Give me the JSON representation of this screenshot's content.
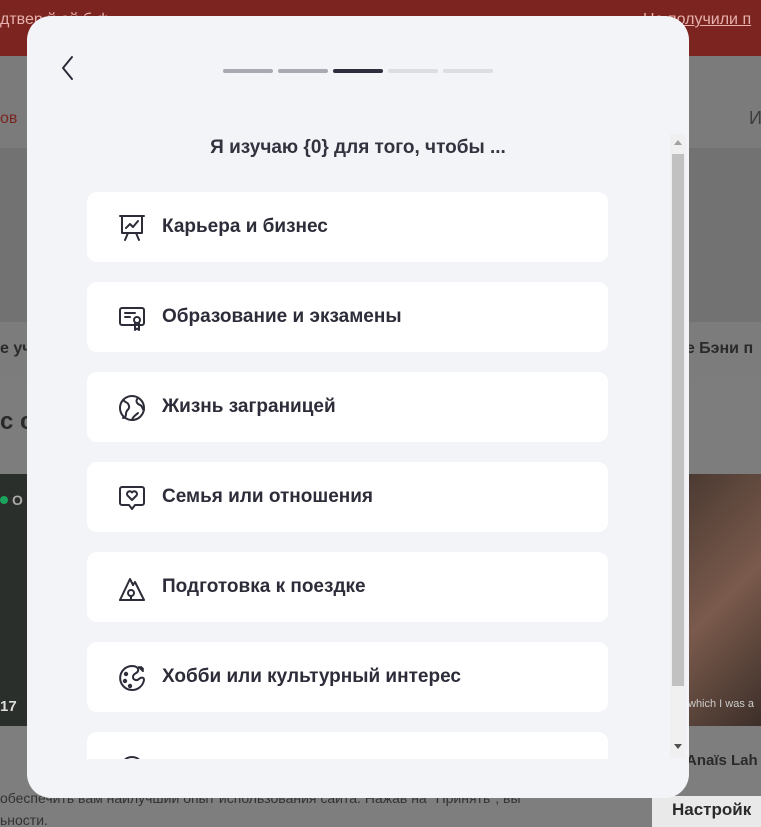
{
  "background": {
    "banner_left": "дтвер    й           ой           б              ф",
    "banner_link": "Не получили п",
    "nav_left": "ов",
    "nav_right": "И",
    "row_left": "е уч",
    "row_right": "те Бэни п",
    "section_left": "с с",
    "online_label": "О",
    "left_card_number": "17",
    "right_card_caption": "which I was a",
    "tutor_name": "Anaïs Lah",
    "cookie_text_1": "обеспечить вам наилучший опыт использования сайта. Нажав на \"Принять\", вы",
    "cookie_text_2": "ьности.",
    "cookie_settings": "Настройк"
  },
  "modal": {
    "back_icon": "chevron-left-icon",
    "progress": {
      "total_steps": 5,
      "current_step": 3
    },
    "title": "Я изучаю {0} для того, чтобы ...",
    "options": [
      {
        "label": "Карьера и бизнес",
        "icon": "presentation-chart-icon"
      },
      {
        "label": "Образование и экзамены",
        "icon": "certificate-icon"
      },
      {
        "label": "Жизнь заграницей",
        "icon": "globe-icon"
      },
      {
        "label": "Семья или отношения",
        "icon": "heart-chat-icon"
      },
      {
        "label": "Подготовка к поездке",
        "icon": "mountain-pin-icon"
      },
      {
        "label": "Хобби или культурный интерес",
        "icon": "palette-icon"
      },
      {
        "label": "",
        "icon": "partial-icon"
      }
    ]
  },
  "colors": {
    "banner": "#7b2420",
    "modal_bg": "#f3f4f8",
    "option_bg": "#ffffff",
    "text": "#2d2d3a",
    "progress_current": "#2d2d3d",
    "progress_done": "#a9a9b3",
    "progress_todo": "#dcdce2"
  }
}
